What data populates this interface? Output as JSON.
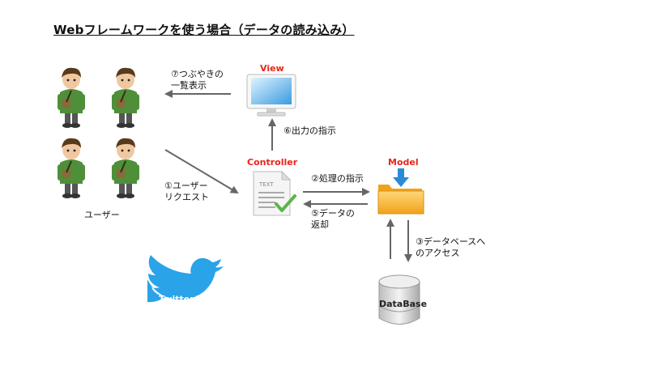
{
  "title": "Webフレームワークを使う場合（データの読み込み）",
  "nodes": {
    "view": "View",
    "controller": "Controller",
    "model": "Model",
    "database": "DataBase",
    "users": "ユーザー",
    "twitter": "TwitterAPI",
    "doc_text": "TEXT"
  },
  "steps": {
    "step1_line1": "①ユーザー",
    "step1_line2": "リクエスト",
    "step2": "②処理の指示",
    "step3_line1": "③データベースへ",
    "step3_line2": "のアクセス",
    "step5_line1": "⑤データの",
    "step5_line2": "返却",
    "step6": "⑥出力の指示",
    "step7_line1": "⑦つぶやきの",
    "step7_line2": "一覧表示"
  },
  "colors": {
    "label_red": "#e8251a",
    "arrow": "#666666",
    "twitter_blue": "#2aa3e8",
    "folder": "#f5b73b",
    "user_shirt": "#4f8f3a"
  }
}
